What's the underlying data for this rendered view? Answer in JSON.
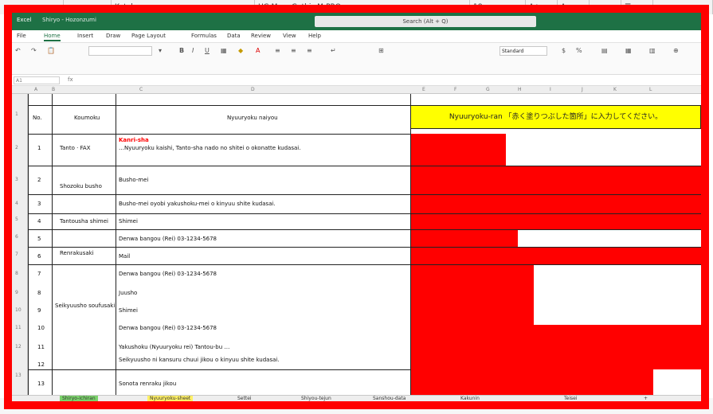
{
  "titlebar": {
    "app_name": "Excel",
    "doc_name": "Shiryo - Hozonzumi",
    "search_placeholder": "Search (Alt + Q)"
  },
  "menus": [
    "File",
    "Home",
    "Insert",
    "Draw",
    "Page Layout",
    "Formulas",
    "Data",
    "Review",
    "View",
    "Help"
  ],
  "ribbon": {
    "number_format": "Standard"
  },
  "formula_bar": {
    "name_box": "A1",
    "fx_label": "fx"
  },
  "columns": [
    "A",
    "B",
    "C",
    "D",
    "E",
    "F",
    "G",
    "H",
    "I",
    "J",
    "K",
    "L"
  ],
  "rows": [
    "1",
    "2",
    "3",
    "4",
    "5",
    "6",
    "7",
    "8",
    "9",
    "10",
    "11",
    "12",
    "13"
  ],
  "table": {
    "header_no": "No.",
    "header_item": "Koumoku",
    "header_content": "Nyuuryoku naiyou",
    "instruction": "Nyuuryoku-ran 「赤く塗りつぶした箇所」に入力してください。",
    "row_numbers": [
      "1",
      "2",
      "3",
      "4",
      "5",
      "6",
      "7",
      "8",
      "9",
      "10",
      "11",
      "12",
      "13"
    ],
    "items": {
      "r1": "Tanto · FAX",
      "r2": "Shozoku busho",
      "r4": "Tantousha shimei",
      "r6": "Renrakusaki",
      "r8": "Seikyuusho soufusaki"
    },
    "contents": {
      "r1_highlight_a": "Kanri-sha",
      "r1_text": "…Nyuuryoku kaishi, Tanto-sha nado no shitei o okonatte kudasai.",
      "r2": "Busho-mei",
      "r3": "Busho-mei oyobi yakushoku-mei o kinyuu shite kudasai.",
      "r4": "Shimei",
      "r5": "Denwa bangou (Rei) 03-1234-5678",
      "r6": "Mail",
      "r7": "Denwa bangou (Rei) 03-1234-5678",
      "r8": "Juusho",
      "r9": "Shimei",
      "r10": "Denwa bangou (Rei) 03-1234-5678",
      "r11": "Yakushoku (Nyuuryoku rei) Tantou-bu …",
      "r12": "Seikyuusho ni kansuru chuui jikou o kinyuu shite kudasai.",
      "r13": "Sonota renraku jikou"
    }
  },
  "sheet_tabs": [
    "Shiryo-ichiran",
    "Nyuuryoku-sheet",
    "Settei",
    "Shiyou-tejun",
    "Sanshou-data",
    "Kakunin",
    "Teisei",
    "+"
  ],
  "background": {
    "top_cells": [
      "",
      "",
      "Katakana",
      "HG Maru Gothic M-PRO",
      "18",
      "A+",
      "A-",
      "≡",
      "☰",
      "▾"
    ],
    "bottom_cells": [
      "",
      "",
      "",
      "",
      "",
      "",
      "",
      "",
      ""
    ]
  }
}
